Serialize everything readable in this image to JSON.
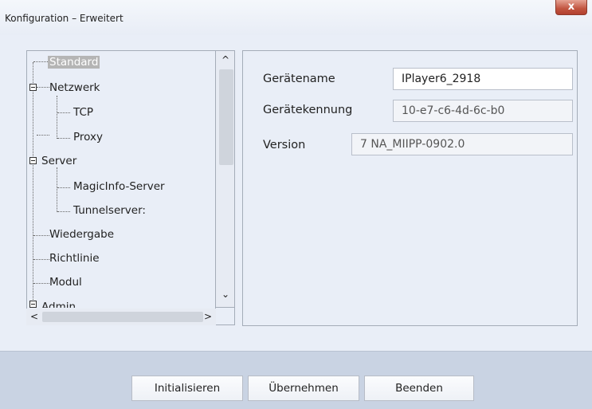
{
  "window": {
    "title": "Konfiguration – Erweitert",
    "close_glyph": "x"
  },
  "tree": {
    "items": [
      {
        "label": "Standard",
        "selected": true
      },
      {
        "label": "Netzwerk",
        "expander": "minus"
      },
      {
        "label": "TCP"
      },
      {
        "label": "Proxy"
      },
      {
        "label": "Server",
        "expander": "minus"
      },
      {
        "label": "MagicInfo-Server"
      },
      {
        "label": "Tunnelserver:"
      },
      {
        "label": "Wiedergabe"
      },
      {
        "label": "Richtlinie"
      },
      {
        "label": "Modul"
      },
      {
        "label": "Admin",
        "expander": "minus"
      }
    ],
    "scroll_up_glyph": "^",
    "scroll_down_glyph": "⌄",
    "scroll_left_glyph": "<",
    "scroll_right_glyph": ">"
  },
  "properties": {
    "device_name_label": "Gerätename",
    "device_name_value": "IPlayer6_2918",
    "device_id_label": "Gerätekennung",
    "device_id_value": "10-e7-c6-4d-6c-b0",
    "version_label": "Version",
    "version_value": "7 NA_MIIPP-0902.0"
  },
  "buttons": {
    "initialize": "Initialisieren",
    "apply": "Übernehmen",
    "exit": "Beenden"
  }
}
